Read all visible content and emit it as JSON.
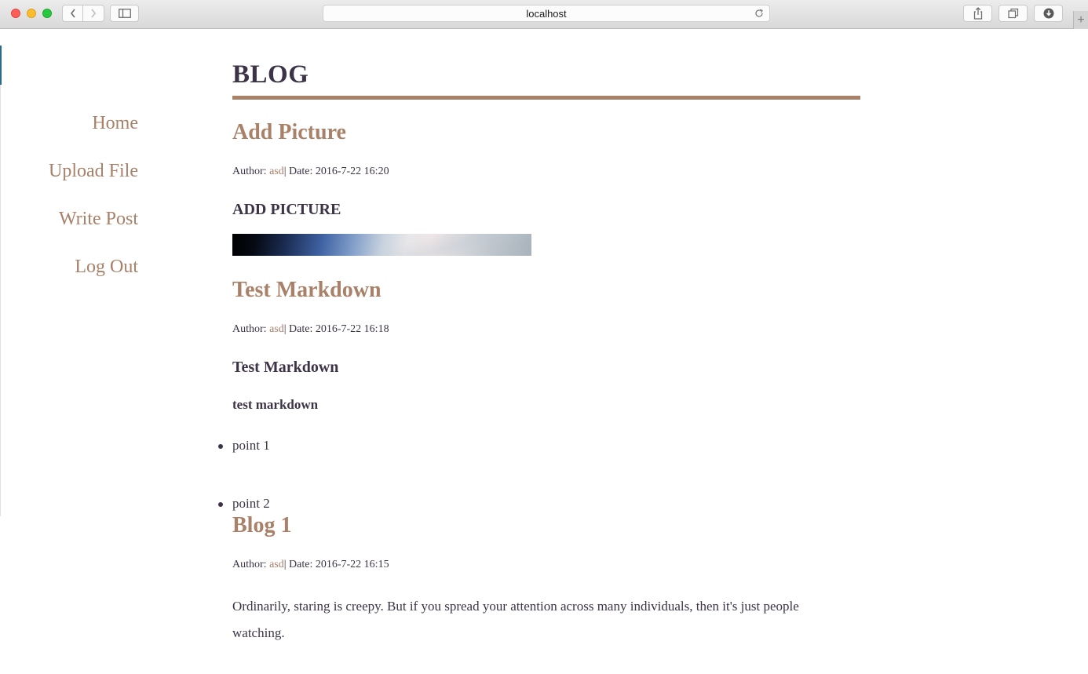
{
  "browser": {
    "url": "localhost"
  },
  "sidebar": {
    "items": [
      {
        "label": "Home"
      },
      {
        "label": "Upload File"
      },
      {
        "label": "Write Post"
      },
      {
        "label": "Log Out"
      }
    ]
  },
  "site": {
    "title": "BLOG"
  },
  "posts": [
    {
      "title": "Add Picture",
      "author_label": "Author:",
      "author": "asd",
      "date_label": "| Date:",
      "date": "2016-7-22 16:20",
      "heading": "ADD PICTURE"
    },
    {
      "title": "Test Markdown",
      "author_label": "Author:",
      "author": "asd",
      "date_label": "| Date:",
      "date": "2016-7-22 16:18",
      "heading": "Test Markdown",
      "bold": "test markdown",
      "bullets": [
        "point 1",
        "point 2"
      ]
    },
    {
      "title": "Blog 1",
      "author_label": "Author:",
      "author": "asd",
      "date_label": "| Date:",
      "date": "2016-7-22 16:15",
      "body": "Ordinarily, staring is creepy. But if you spread your attention across many individuals, then it's just people watching."
    }
  ]
}
